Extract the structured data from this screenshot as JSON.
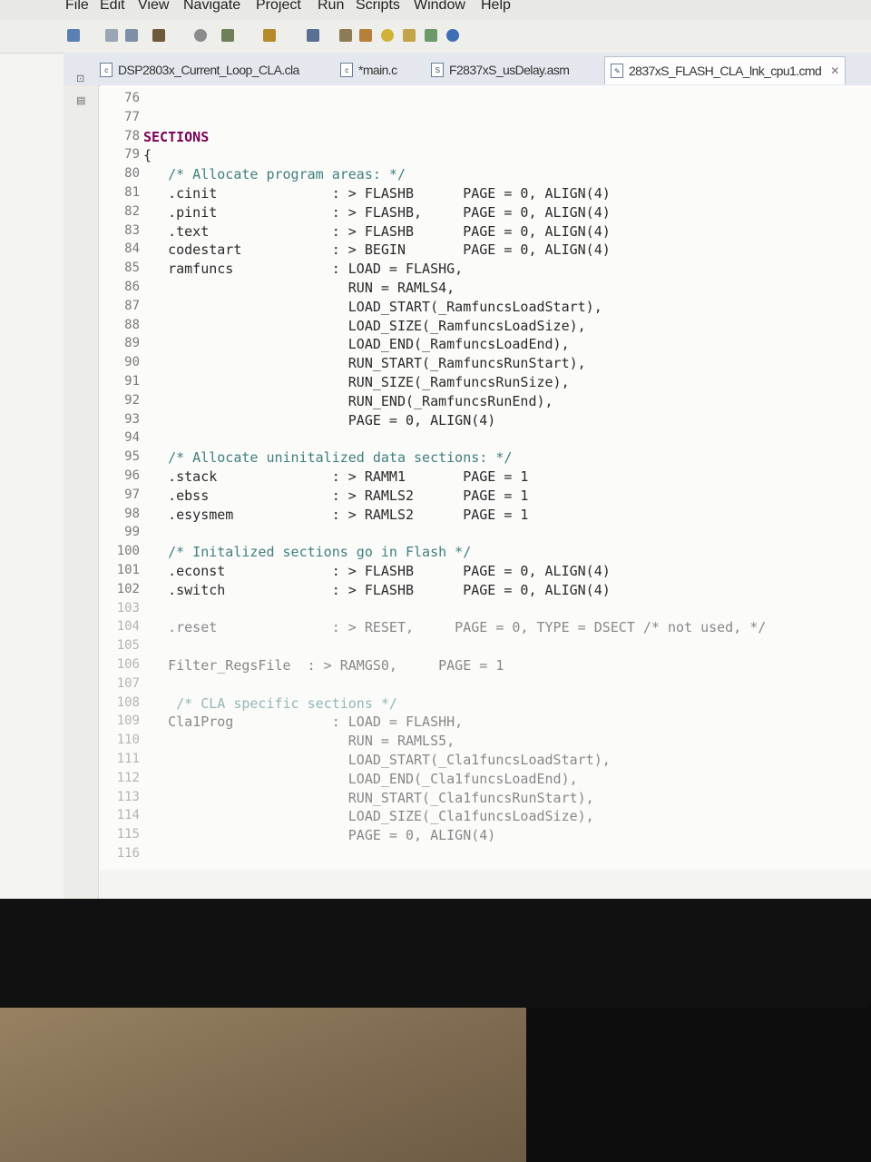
{
  "menu": [
    "File",
    "Edit",
    "View",
    "Navigate",
    "Project",
    "Run",
    "Scripts",
    "Window",
    "Help"
  ],
  "tabs": [
    {
      "icon": "cla-file-icon",
      "label": "DSP2803x_Current_Loop_CLA.cla"
    },
    {
      "icon": "c-file-icon",
      "label": "*main.c"
    },
    {
      "icon": "asm-file-icon",
      "label": "F2837xS_usDelay.asm"
    },
    {
      "icon": "cmd-file-icon",
      "label": "2837xS_FLASH_CLA_lnk_cpu1.cmd"
    }
  ],
  "code": [
    {
      "n": "76",
      "t": ""
    },
    {
      "n": "77",
      "t": ""
    },
    {
      "n": "78",
      "t": "SECTIONS"
    },
    {
      "n": "79",
      "t": "{"
    },
    {
      "n": "80",
      "t": "   /* Allocate program areas: */"
    },
    {
      "n": "81",
      "t": "   .cinit              : > FLASHB      PAGE = 0, ALIGN(4)"
    },
    {
      "n": "82",
      "t": "   .pinit              : > FLASHB,     PAGE = 0, ALIGN(4)"
    },
    {
      "n": "83",
      "t": "   .text               : > FLASHB      PAGE = 0, ALIGN(4)"
    },
    {
      "n": "84",
      "t": "   codestart           : > BEGIN       PAGE = 0, ALIGN(4)"
    },
    {
      "n": "85",
      "t": "   ramfuncs            : LOAD = FLASHG,"
    },
    {
      "n": "86",
      "t": "                         RUN = RAMLS4,"
    },
    {
      "n": "87",
      "t": "                         LOAD_START(_RamfuncsLoadStart),"
    },
    {
      "n": "88",
      "t": "                         LOAD_SIZE(_RamfuncsLoadSize),"
    },
    {
      "n": "89",
      "t": "                         LOAD_END(_RamfuncsLoadEnd),"
    },
    {
      "n": "90",
      "t": "                         RUN_START(_RamfuncsRunStart),"
    },
    {
      "n": "91",
      "t": "                         RUN_SIZE(_RamfuncsRunSize),"
    },
    {
      "n": "92",
      "t": "                         RUN_END(_RamfuncsRunEnd),"
    },
    {
      "n": "93",
      "t": "                         PAGE = 0, ALIGN(4)"
    },
    {
      "n": "94",
      "t": ""
    },
    {
      "n": "95",
      "t": "   /* Allocate uninitalized data sections: */"
    },
    {
      "n": "96",
      "t": "   .stack              : > RAMM1       PAGE = 1"
    },
    {
      "n": "97",
      "t": "   .ebss               : > RAMLS2      PAGE = 1"
    },
    {
      "n": "98",
      "t": "   .esysmem            : > RAMLS2      PAGE = 1"
    },
    {
      "n": "99",
      "t": ""
    },
    {
      "n": "100",
      "t": "   /* Initalized sections go in Flash */"
    },
    {
      "n": "101",
      "t": "   .econst             : > FLASHB      PAGE = 0, ALIGN(4)"
    },
    {
      "n": "102",
      "t": "   .switch             : > FLASHB      PAGE = 0, ALIGN(4)"
    },
    {
      "n": "103",
      "t": ""
    },
    {
      "n": "104",
      "t": "   .reset              : > RESET,     PAGE = 0, TYPE = DSECT /* not used, */"
    },
    {
      "n": "105",
      "t": ""
    },
    {
      "n": "106",
      "t": "   Filter_RegsFile  : > RAMGS0,     PAGE = 1"
    },
    {
      "n": "107",
      "t": ""
    },
    {
      "n": "108",
      "t": "    /* CLA specific sections */"
    },
    {
      "n": "109",
      "t": "   Cla1Prog            : LOAD = FLASHH,"
    },
    {
      "n": "110",
      "t": "                         RUN = RAMLS5,"
    },
    {
      "n": "111",
      "t": "                         LOAD_START(_Cla1funcsLoadStart),"
    },
    {
      "n": "112",
      "t": "                         LOAD_END(_Cla1funcsLoadEnd),"
    },
    {
      "n": "113",
      "t": "                         RUN_START(_Cla1funcsRunStart),"
    },
    {
      "n": "114",
      "t": "                         LOAD_SIZE(_Cla1funcsLoadSize),"
    },
    {
      "n": "115",
      "t": "                         PAGE = 0, ALIGN(4)"
    },
    {
      "n": "116",
      "t": ""
    }
  ]
}
